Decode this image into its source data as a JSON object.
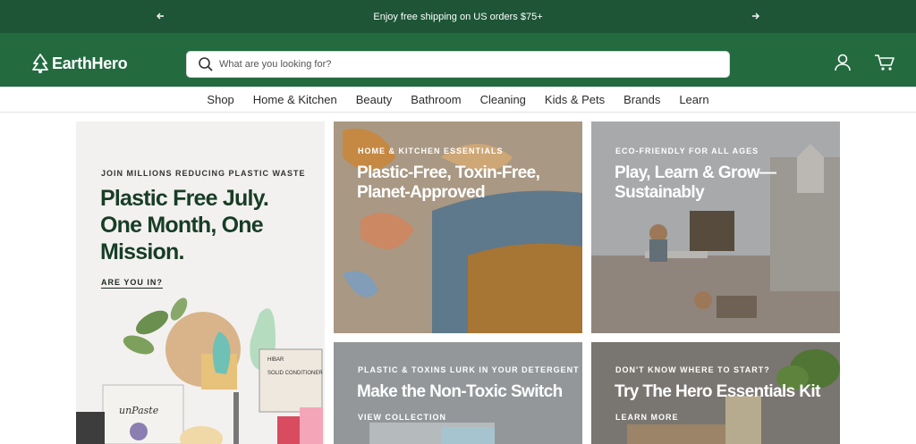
{
  "announcement": {
    "message": "Enjoy free shipping on US orders $75+",
    "prev_icon": "arrow-left-icon",
    "next_icon": "arrow-right-icon"
  },
  "header": {
    "logo_text": "EarthHero",
    "logo_icon": "tree-icon",
    "search": {
      "placeholder": "What are you looking for?",
      "value": "",
      "icon": "search-icon"
    },
    "account_icon": "user-icon",
    "cart_icon": "cart-icon",
    "colors": {
      "brand": "#236b3f",
      "announce": "#1d5536"
    }
  },
  "nav": {
    "items": [
      "Shop",
      "Home & Kitchen",
      "Beauty",
      "Bathroom",
      "Cleaning",
      "Kids & Pets",
      "Brands",
      "Learn"
    ]
  },
  "hero": {
    "eyebrow": "JOIN MILLIONS REDUCING PLASTIC WASTE",
    "headline": "Plastic Free July. One Month, One Mission.",
    "cta": "ARE YOU IN?"
  },
  "cards": [
    {
      "eyebrow": "HOME & KITCHEN ESSENTIALS",
      "title": "Plastic-Free, Toxin-Free, Planet-Approved",
      "link": ""
    },
    {
      "eyebrow": "ECO-FRIENDLY FOR ALL AGES",
      "title": "Play, Learn & Grow— Sustainably",
      "link": ""
    },
    {
      "eyebrow": "PLASTIC & TOXINS LURK IN YOUR DETERGENT",
      "title": "Make the Non-Toxic Switch",
      "link": "VIEW COLLECTION"
    },
    {
      "eyebrow": "DON'T KNOW WHERE TO START?",
      "title": "Try The Hero Essentials Kit",
      "link": "LEARN MORE"
    }
  ],
  "product_labels": {
    "conditioner_brand": "HIBAR",
    "conditioner_type": "SOLID CONDITIONER",
    "paste_brand": "unPaste"
  }
}
